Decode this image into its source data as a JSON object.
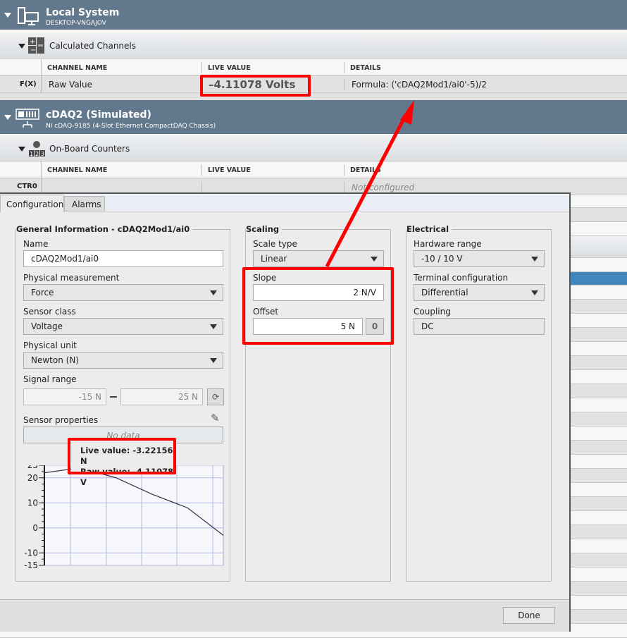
{
  "local_system": {
    "title": "Local System",
    "subtitle": "DESKTOP-VNGAJOV",
    "icon": "computer-icon"
  },
  "calculated": {
    "title": "Calculated Channels",
    "icon": "calculator-icon",
    "columns": [
      "CHANNEL NAME",
      "LIVE VALUE",
      "DETAILS"
    ],
    "row": {
      "prefix": "F(X)",
      "name": "Raw Value",
      "live": "–4.11078 Volts",
      "details": "Formula: ('cDAQ2Mod1/ai0'-5)/2"
    }
  },
  "chassis": {
    "title": "cDAQ2 (Simulated)",
    "subtitle": "NI cDAQ-9185 (4-Slot Ethernet CompactDAQ Chassis)",
    "icon": "chassis-network-icon"
  },
  "counters": {
    "title": "On-Board Counters",
    "icon": "counter-icon",
    "columns": [
      "CHANNEL NAME",
      "LIVE VALUE",
      "DETAILS"
    ],
    "row": {
      "prefix": "CTR0",
      "name": "",
      "live": "",
      "details": "Not configured"
    }
  },
  "dialog": {
    "tabs": [
      {
        "label": "Configuration",
        "active": true
      },
      {
        "label": "Alarms",
        "active": false
      }
    ],
    "general": {
      "title": "General Information - cDAQ2Mod1/ai0",
      "name_label": "Name",
      "name_value": "cDAQ2Mod1/ai0",
      "phys_label": "Physical measurement",
      "phys_value": "Force",
      "sensor_label": "Sensor class",
      "sensor_value": "Voltage",
      "unit_label": "Physical unit",
      "unit_value": "Newton (N)",
      "range_label": "Signal range",
      "range_min": "-15 N",
      "range_max": "25 N",
      "props_label": "Sensor properties",
      "props_value": "No data",
      "tooltip_live": "Live value: -3.22156 N",
      "tooltip_raw": "Raw value: -4.11078 V"
    },
    "scaling": {
      "title": "Scaling",
      "type_label": "Scale type",
      "type_value": "Linear",
      "slope_label": "Slope",
      "slope_value": "2 N/V",
      "offset_label": "Offset",
      "offset_value": "5 N",
      "zero_button": "0"
    },
    "electrical": {
      "title": "Electrical",
      "hw_label": "Hardware range",
      "hw_value": "-10 / 10 V",
      "term_label": "Terminal configuration",
      "term_value": "Differential",
      "coupling_label": "Coupling",
      "coupling_value": "DC"
    },
    "done_label": "Done"
  },
  "colors": {
    "header": "#62788c",
    "highlight": "#f00000",
    "selected_row": "#4186bd"
  },
  "chart_data": {
    "type": "line",
    "title": "",
    "xlabel": "",
    "ylabel": "",
    "ylim": [
      -15,
      25
    ],
    "yticks": [
      "25",
      "20",
      "10",
      "0",
      "-10",
      "-15"
    ],
    "grid": true,
    "x": [
      0,
      1,
      2,
      3,
      4,
      5
    ],
    "values": [
      22,
      24,
      20,
      13.5,
      8,
      -3
    ]
  }
}
